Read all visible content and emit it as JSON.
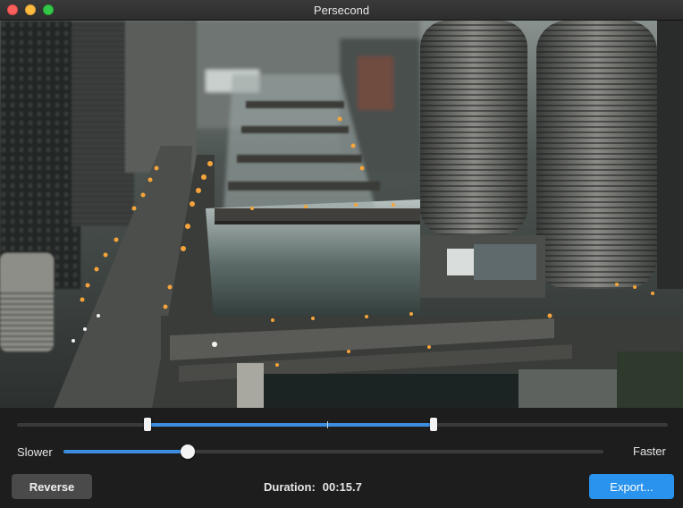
{
  "window": {
    "title": "Persecond"
  },
  "trim": {
    "start_fraction": 0.2,
    "end_fraction": 0.64,
    "playhead_fraction": 0.477
  },
  "speed": {
    "slower_label": "Slower",
    "faster_label": "Faster",
    "value_fraction": 0.23
  },
  "footer": {
    "reverse_label": "Reverse",
    "duration_label": "Duration:",
    "duration_value": "00:15.7",
    "export_label": "Export..."
  },
  "colors": {
    "accent": "#3d8ee0",
    "export_button": "#2a93ee",
    "background": "#1d1d1d"
  }
}
